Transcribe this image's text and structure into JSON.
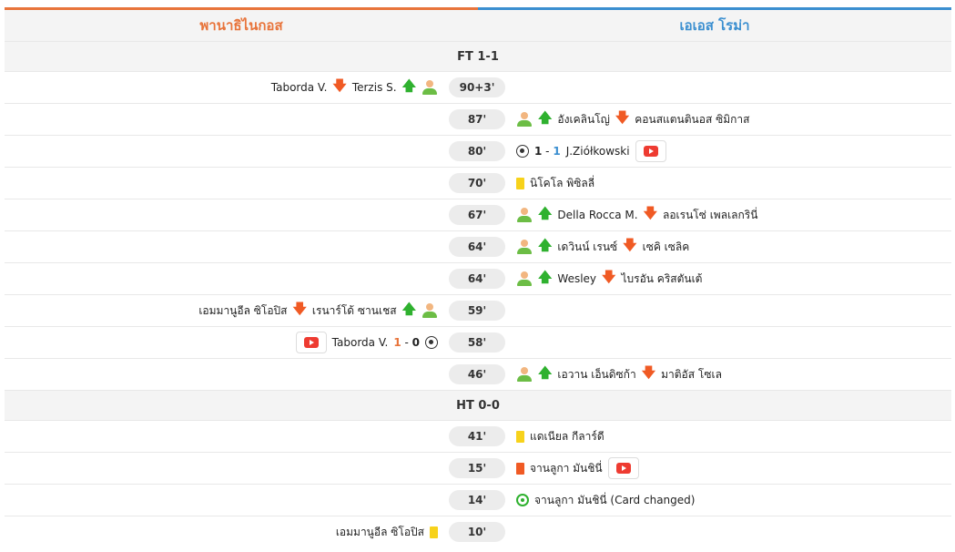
{
  "teams": {
    "home": "พานาธิไนกอส",
    "away": "เอเอส โรม่า"
  },
  "colors": {
    "home": "#e8743b",
    "away": "#3b8fd0",
    "sub_in": "#2fb12f",
    "sub_out": "#f05a24"
  },
  "full_time": "FT 1-1",
  "half_time": "HT 0-0",
  "events_second_half": [
    {
      "minute": "90+3'",
      "side": "home",
      "type": "sub",
      "in": "Terzis S.",
      "out": "Taborda V."
    },
    {
      "minute": "87'",
      "side": "away",
      "type": "sub",
      "in": "อังเคลินโญ่",
      "out": "คอนสแตนตินอส ซิมิกาส"
    },
    {
      "minute": "80'",
      "side": "away",
      "type": "goal",
      "score_home": "1",
      "score_away": "1",
      "player": "J.Ziółkowski",
      "video": true
    },
    {
      "minute": "70'",
      "side": "away",
      "type": "yellow",
      "player": "นิโคโล พิซิลลี่"
    },
    {
      "minute": "67'",
      "side": "away",
      "type": "sub",
      "in": "Della Rocca M.",
      "out": "ลอเรนโซ่ เพลเลกรินี่"
    },
    {
      "minute": "64'",
      "side": "away",
      "type": "sub",
      "in": "เดวินน์ เรนซ์",
      "out": "เซคิ เซลิค"
    },
    {
      "minute": "64'",
      "side": "away",
      "type": "sub",
      "in": "Wesley",
      "out": "ไบรอัน คริสตันเต้"
    },
    {
      "minute": "59'",
      "side": "home",
      "type": "sub",
      "in": "เรนาร์โด้ ซานเชส",
      "out": "เอมมานูอีล ซิโอปิส"
    },
    {
      "minute": "58'",
      "side": "home",
      "type": "goal",
      "score_home": "1",
      "score_away": "0",
      "player": "Taborda V.",
      "video": true
    },
    {
      "minute": "46'",
      "side": "away",
      "type": "sub",
      "in": "เอวาน เอ็นดิซก้า",
      "out": "มาติอัส โซเล"
    }
  ],
  "events_first_half": [
    {
      "minute": "41'",
      "side": "away",
      "type": "yellow",
      "player": "แดเนียล กีลาร์ดี"
    },
    {
      "minute": "15'",
      "side": "away",
      "type": "red",
      "player": "จานลูกา มันชินี่",
      "video": true
    },
    {
      "minute": "14'",
      "side": "away",
      "type": "var",
      "player": "จานลูกา มันชินี่ (Card changed)"
    },
    {
      "minute": "10'",
      "side": "home",
      "type": "yellow",
      "player": "เอมมานูอีล ซิโอปิส"
    }
  ]
}
